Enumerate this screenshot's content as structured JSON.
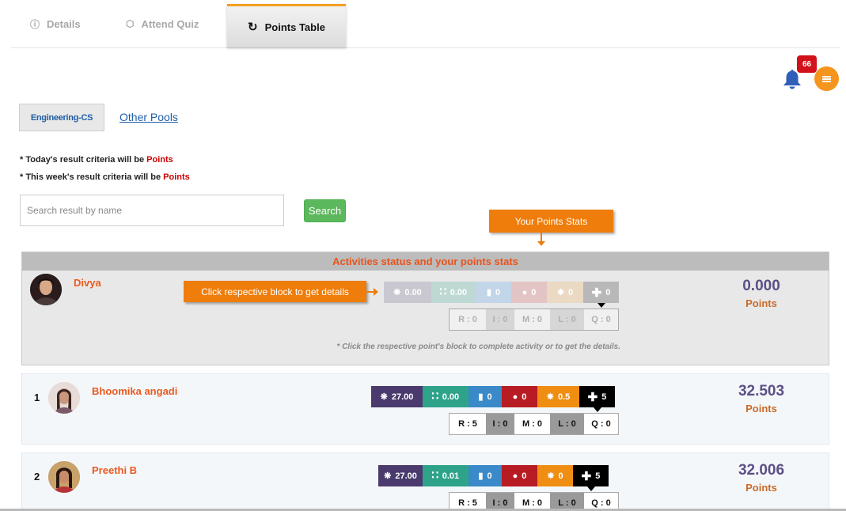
{
  "tabs": [
    {
      "label": "Details",
      "icon": "info-icon"
    },
    {
      "label": "Attend Quiz",
      "icon": "cube-icon"
    },
    {
      "label": "Points Table",
      "icon": "refresh-icon",
      "active": true
    }
  ],
  "notifications": {
    "count": "66"
  },
  "pools": {
    "active": "Engineering-CS",
    "other": "Other Pools"
  },
  "criteria": {
    "today_prefix": "* Today's result criteria will be ",
    "today_value": "Points",
    "week_prefix": "* This week's result criteria will be ",
    "week_value": "Points"
  },
  "search": {
    "placeholder": "Search result by name",
    "button": "Search"
  },
  "callouts": {
    "stats": "Your Points Stats",
    "block": "Click respective block to get details"
  },
  "my_panel": {
    "header": "Activities status and your points stats",
    "name": "Divya",
    "stats": {
      "quiz": "0.00",
      "trophy": "0.00",
      "book": "0",
      "chat": "0",
      "bulb": "0",
      "plus": "0"
    },
    "sub": {
      "r": "R : 0",
      "i": "I : 0",
      "m": "M : 0",
      "l": "L : 0",
      "q": "Q : 0"
    },
    "score": "0.000",
    "score_label": "Points",
    "note": "* Click the respective point's block to complete activity or to get the details."
  },
  "rows": [
    {
      "rank": "1",
      "name": "Bhoomika angadi",
      "stats": {
        "quiz": "27.00",
        "trophy": "0.00",
        "book": "0",
        "chat": "0",
        "bulb": "0.5",
        "plus": "5"
      },
      "sub": {
        "r": "R : 5",
        "i": "I : 0",
        "m": "M : 0",
        "l": "L : 0",
        "q": "Q : 0"
      },
      "score": "32.503",
      "score_label": "Points"
    },
    {
      "rank": "2",
      "name": "Preethi B",
      "stats": {
        "quiz": "27.00",
        "trophy": "0.01",
        "book": "0",
        "chat": "0",
        "bulb": "0",
        "plus": "5"
      },
      "sub": {
        "r": "R : 5",
        "i": "I : 0",
        "m": "M : 0",
        "l": "L : 0",
        "q": "Q : 0"
      },
      "score": "32.006",
      "score_label": "Points"
    }
  ],
  "colors": {
    "accent": "#ef7d0b",
    "name": "#ea5a1f",
    "score": "#5c4f86",
    "search": "#5cb85c"
  }
}
